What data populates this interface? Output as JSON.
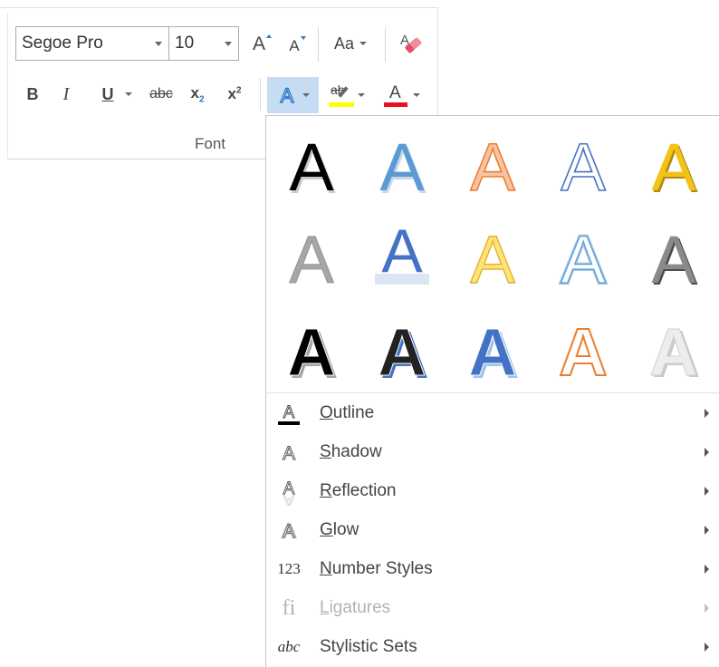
{
  "ribbon": {
    "group_label": "Font",
    "font_name": {
      "value": "Segoe Pro"
    },
    "font_size": {
      "value": "10"
    },
    "buttons": {
      "grow_font": "A",
      "shrink_font": "A",
      "change_case": "Aa",
      "bold": "B",
      "italic": "I",
      "underline": "U",
      "strikethrough": "abc",
      "subscript": "x",
      "subscript_mark": "2",
      "superscript": "x",
      "superscript_mark": "2",
      "text_effects": "A",
      "highlight": "ab",
      "font_color": "A"
    },
    "colors": {
      "highlight": "#ffff00",
      "font_color": "#e81123",
      "accent": "#2b579a",
      "active_button_bg": "#c5dcf3"
    }
  },
  "gallery": {
    "letter": "A",
    "styles": [
      "Fill: Black, Text color 1; Shadow",
      "Fill: Blue, Accent color 1; Shadow",
      "Fill: Orange, Accent color 2; Outline",
      "Fill: White; Outline: Blue",
      "Fill: Gold, Accent color 4; Soft Bevel",
      "Gradient Fill: Gray",
      "Fill: Blue; Reflection",
      "Fill: Gold; Outline",
      "Fill: White; Outline: Blue; Glow",
      "Fill: Gray; Bevel",
      "Fill: Black; Shadow",
      "Fill: Black; Outline: Blue",
      "Fill: Blue; Offset",
      "Fill: White; Outline: Orange",
      "Fill: White; Gradient Gray"
    ]
  },
  "menu": {
    "items": [
      {
        "icon": "outline-icon",
        "access_key": "O",
        "rest": "utline",
        "enabled": true
      },
      {
        "icon": "shadow-icon",
        "access_key": "S",
        "rest": "hadow",
        "enabled": true
      },
      {
        "icon": "reflection-icon",
        "access_key": "R",
        "rest": "eflection",
        "enabled": true
      },
      {
        "icon": "glow-icon",
        "access_key": "G",
        "rest": "low",
        "enabled": true
      },
      {
        "icon": "number-styles-icon",
        "icon_text": "123",
        "access_key": "N",
        "rest": "umber Styles",
        "enabled": true
      },
      {
        "icon": "ligatures-icon",
        "icon_text": "fi",
        "access_key": "L",
        "rest": "igatures",
        "enabled": false
      },
      {
        "icon": "stylistic-sets-icon",
        "icon_text": "abc",
        "access_key": "",
        "rest": "Stylistic Sets",
        "enabled": true
      }
    ]
  }
}
